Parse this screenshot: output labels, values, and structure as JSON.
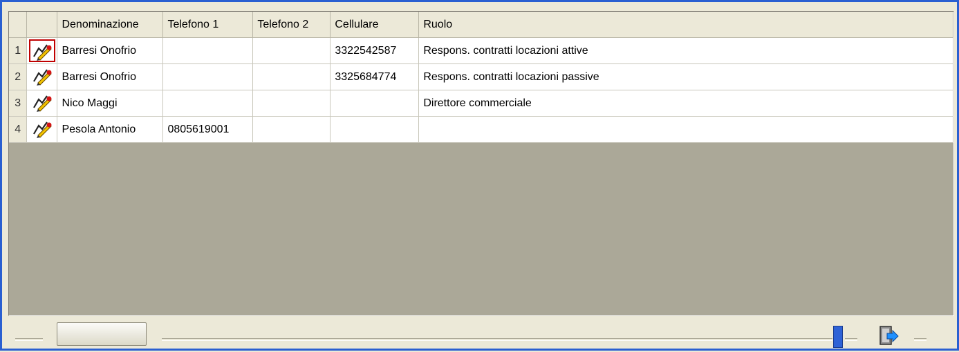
{
  "grid": {
    "columns": [
      "",
      "",
      "Denominazione",
      "Telefono 1",
      "Telefono 2",
      "Cellulare",
      "Ruolo"
    ],
    "rows": [
      {
        "num": "1",
        "denominazione": "Barresi Onofrio",
        "telefono1": "",
        "telefono2": "",
        "cellulare": "3322542587",
        "ruolo": "Respons. contratti locazioni attive"
      },
      {
        "num": "2",
        "denominazione": "Barresi Onofrio",
        "telefono1": "",
        "telefono2": "",
        "cellulare": "3325684774",
        "ruolo": "Respons. contratti locazioni passive"
      },
      {
        "num": "3",
        "denominazione": "Nico Maggi",
        "telefono1": "",
        "telefono2": "",
        "cellulare": "",
        "ruolo": "Direttore commerciale"
      },
      {
        "num": "4",
        "denominazione": "Pesola Antonio",
        "telefono1": "0805619001",
        "telefono2": "",
        "cellulare": "",
        "ruolo": ""
      }
    ],
    "row_icon": "edit-pencil-icon",
    "selected_row_icon": 0
  },
  "footer": {
    "scroll_thumb_icon": "scroll-thumb",
    "slider_handle_icon": "slider-handle",
    "exit_icon": "exit-door-icon"
  },
  "colors": {
    "frame_border": "#2a5fd1",
    "empty_area": "#aba898",
    "selection_border": "#c00000",
    "slider": "#2e62d6"
  }
}
